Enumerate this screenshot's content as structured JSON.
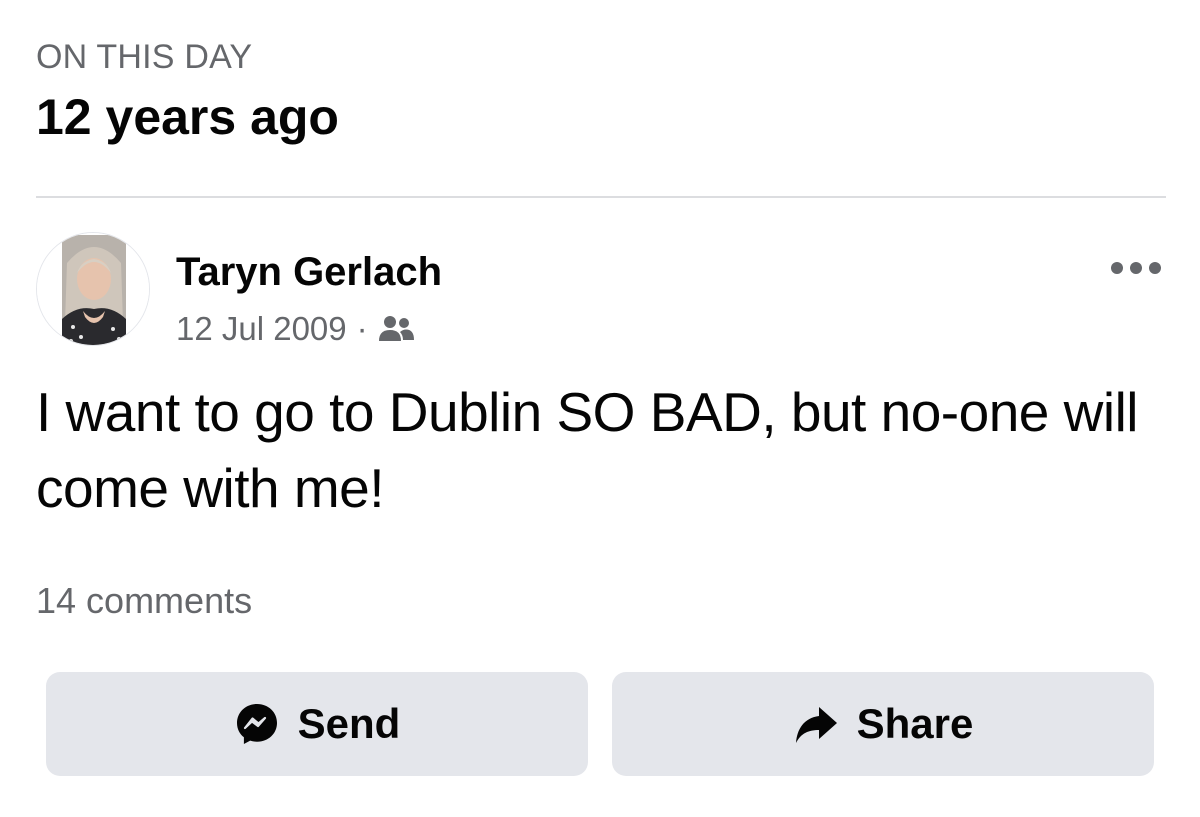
{
  "memory": {
    "kicker": "ON THIS DAY",
    "headline": "12 years ago"
  },
  "post": {
    "author": "Taryn Gerlach",
    "date": "12 Jul 2009",
    "separator": "·",
    "audience_icon": "friends-icon",
    "more_icon": "more-options-icon",
    "text": "I want to go to Dublin SO BAD, but no-one will come with me!",
    "comments": "14 comments"
  },
  "actions": {
    "send_label": "Send",
    "send_icon": "messenger-icon",
    "share_label": "Share",
    "share_icon": "share-arrow-icon"
  },
  "colors": {
    "primary_text": "#050505",
    "secondary_text": "#65676b",
    "button_bg": "#e4e6eb",
    "divider": "#dcdde0"
  }
}
